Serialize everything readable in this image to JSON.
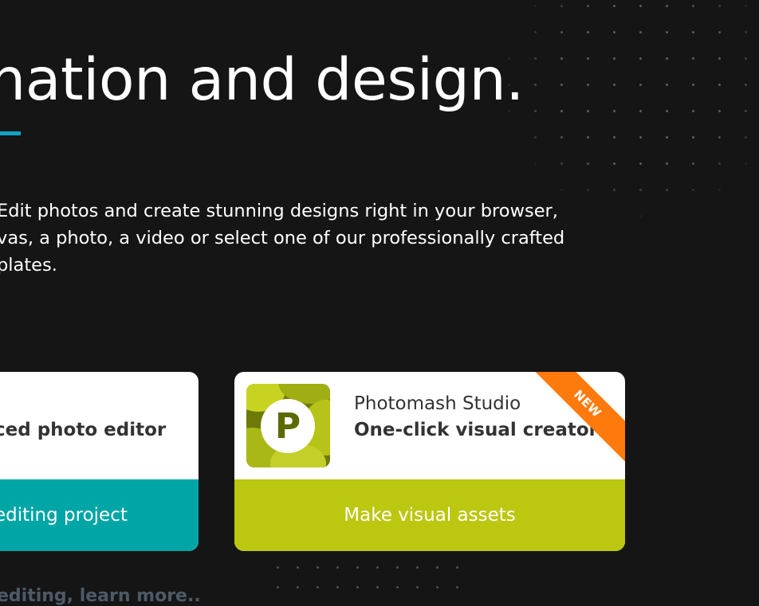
{
  "hero": {
    "headline": "nation and design.",
    "description_lines": [
      "Edit photos and create stunning designs right in your browser,",
      "vas, a photo, a video or select one of our professionally crafted",
      "plates."
    ]
  },
  "cards": {
    "left": {
      "subtitle": "ced photo editor",
      "button_label": "editing project"
    },
    "right": {
      "logo_letter": "P",
      "product_name": "Photomash Studio",
      "tagline": "One-click visual creator",
      "badge": "NEW",
      "button_label": "Make visual assets"
    }
  },
  "footer": {
    "learn_more": "editing, learn more.."
  },
  "colors": {
    "background": "#151516",
    "accent_blue": "#11a3c7",
    "teal_button": "#00a6a6",
    "lime_button": "#bcc70f",
    "badge_orange": "#ff7a0d"
  },
  "icons": {
    "logo": "photomash-p-logo"
  }
}
